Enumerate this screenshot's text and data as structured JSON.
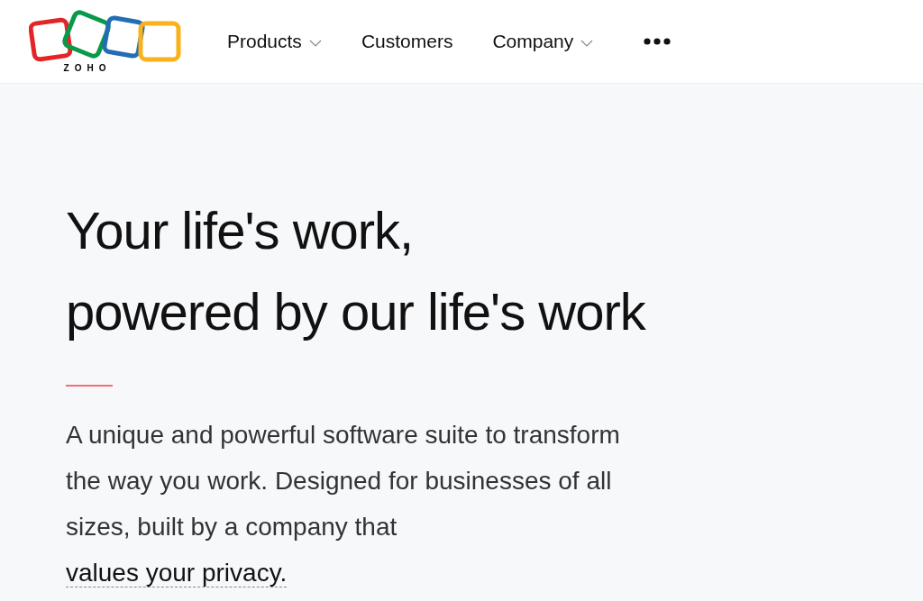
{
  "header": {
    "logo": {
      "text": "ZOHO"
    },
    "nav": [
      {
        "label": "Products",
        "has_dropdown": true
      },
      {
        "label": "Customers",
        "has_dropdown": false
      },
      {
        "label": "Company",
        "has_dropdown": true
      }
    ],
    "more_menu": true
  },
  "hero": {
    "headline_lines": [
      "Your life's work,",
      "powered by our life's work"
    ],
    "intro": "A unique and powerful software suite to transform the way you work. Designed for businesses of all sizes, built by a company that",
    "intro_link": "values your privacy."
  }
}
